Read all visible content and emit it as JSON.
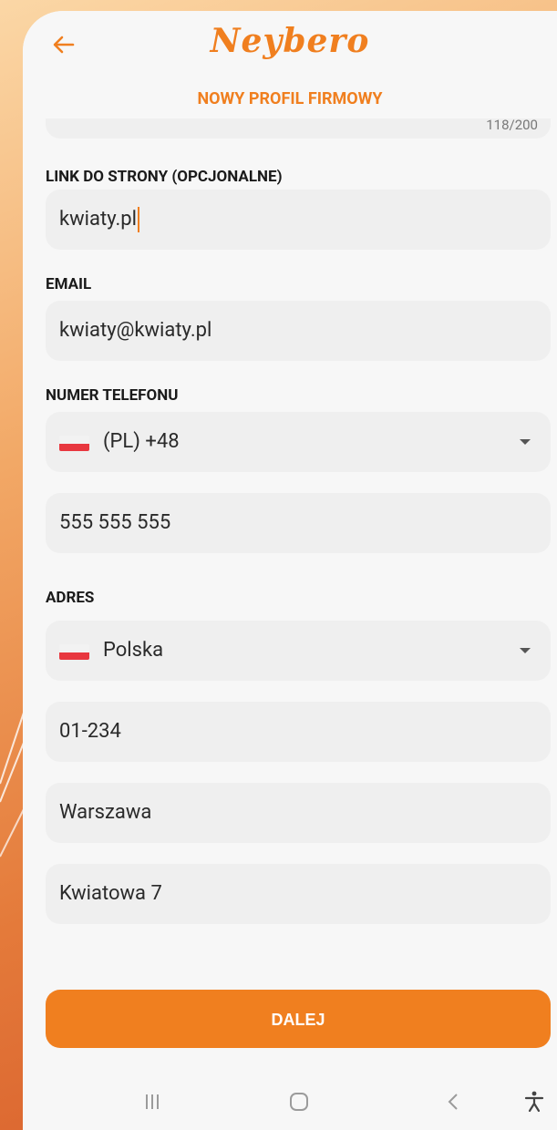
{
  "header": {
    "logo": "Neybero",
    "title": "NOWY PROFIL FIRMOWY"
  },
  "description_field": {
    "counter": "118/200"
  },
  "website": {
    "label": "LINK DO STRONY (OPCJONALNE)",
    "value": "kwiaty.pl"
  },
  "email": {
    "label": "EMAIL",
    "value": "kwiaty@kwiaty.pl"
  },
  "phone": {
    "label": "NUMER TELEFONU",
    "country_code": "(PL) +48",
    "number": "555 555 555"
  },
  "address": {
    "label": "ADRES",
    "country": "Polska",
    "postal_code": "01-234",
    "city": "Warszawa",
    "street": "Kwiatowa 7"
  },
  "actions": {
    "next_label": "DALEJ"
  },
  "system_nav": {
    "icons": [
      "recent-apps-icon",
      "home-icon",
      "back-icon",
      "accessibility-icon"
    ]
  },
  "colors": {
    "accent": "#f07f1f",
    "field_bg": "#efefef",
    "flag_red": "#e8373f"
  }
}
